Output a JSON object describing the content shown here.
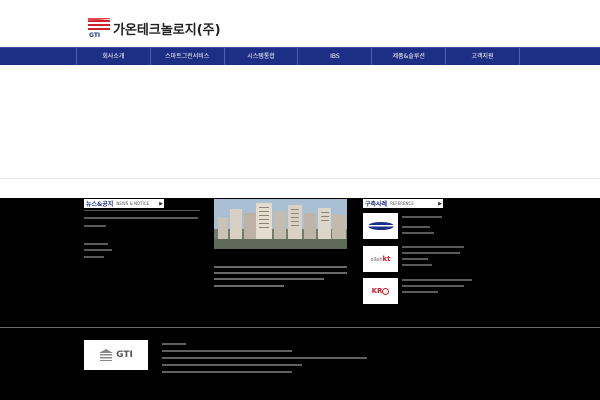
{
  "header": {
    "company_name": "가온테크놀로지(주)",
    "logo_initials": "GTI"
  },
  "nav": {
    "items": [
      {
        "label": "회사소개"
      },
      {
        "label": "스마트그린서비스"
      },
      {
        "label": "시스템통합"
      },
      {
        "label": "IBS"
      },
      {
        "label": "제품&솔루션"
      },
      {
        "label": "고객지원"
      }
    ]
  },
  "news": {
    "title": "뉴스&공지",
    "subtitle": "NEWS & NOTICE"
  },
  "reference": {
    "title": "구축사례",
    "subtitle": "REFERENCE",
    "logos": [
      {
        "text": "",
        "icon": "generic-logo-icon"
      },
      {
        "text": "olleh kt",
        "icon": "olleh-kt-logo"
      },
      {
        "text": "KRC",
        "icon": "krc-logo"
      }
    ]
  },
  "footer": {
    "logo_text": "GTI"
  },
  "colors": {
    "nav_bg": "#1d2f84",
    "brand_red": "#d21f2b",
    "content_bg": "#000000"
  }
}
